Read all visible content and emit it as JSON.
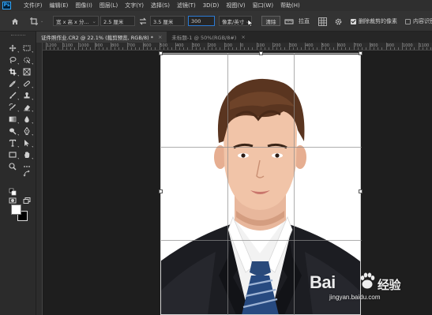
{
  "app": {
    "logo": "Ps"
  },
  "menu": [
    "文件(F)",
    "编辑(E)",
    "图像(I)",
    "图层(L)",
    "文字(Y)",
    "选择(S)",
    "滤镜(T)",
    "3D(D)",
    "视图(V)",
    "窗口(W)",
    "帮助(H)"
  ],
  "options": {
    "ratio_select": "宽 x 高 x 分...",
    "width_value": "2.5 厘米",
    "height_value": "3.5 厘米",
    "resolution_value": "300",
    "resolution_unit": "像素/英寸",
    "clear_label": "清除",
    "straighten_label": "拉直",
    "delete_cropped_label": "删除裁剪的像素",
    "content_aware_label": "内容识别"
  },
  "tabs": [
    {
      "label": "证件照作业.CR2 @ 22.1% (裁剪预览, RGB/8) *",
      "close": "×"
    },
    {
      "label": "未标题-1 @ 50%(RGB/8#)",
      "close": "×"
    }
  ],
  "ruler": {
    "labels": [
      "1200",
      "1100",
      "1000",
      "900",
      "800",
      "700",
      "600",
      "500",
      "400",
      "300",
      "200",
      "100",
      "0",
      "100",
      "200",
      "300",
      "400",
      "500",
      "600",
      "700",
      "800",
      "900",
      "1000",
      "1100",
      "1200"
    ]
  },
  "colors": {
    "foreground": "#ffffff",
    "background": "#000000",
    "accent": "#2b7bd6"
  },
  "watermark": {
    "brand": "Bai",
    "brand2": "经验",
    "site": "jingyan.baidu.com"
  },
  "icons": [
    "move-icon",
    "marquee-icon",
    "lasso-icon",
    "quick-select-icon",
    "crop-icon",
    "frame-icon",
    "eyedropper-icon",
    "healing-icon",
    "brush-icon",
    "stamp-icon",
    "history-brush-icon",
    "eraser-icon",
    "gradient-icon",
    "blur-icon",
    "dodge-icon",
    "pen-icon",
    "type-icon",
    "path-select-icon",
    "rectangle-icon",
    "hand-icon",
    "zoom-icon",
    "more-icon"
  ]
}
